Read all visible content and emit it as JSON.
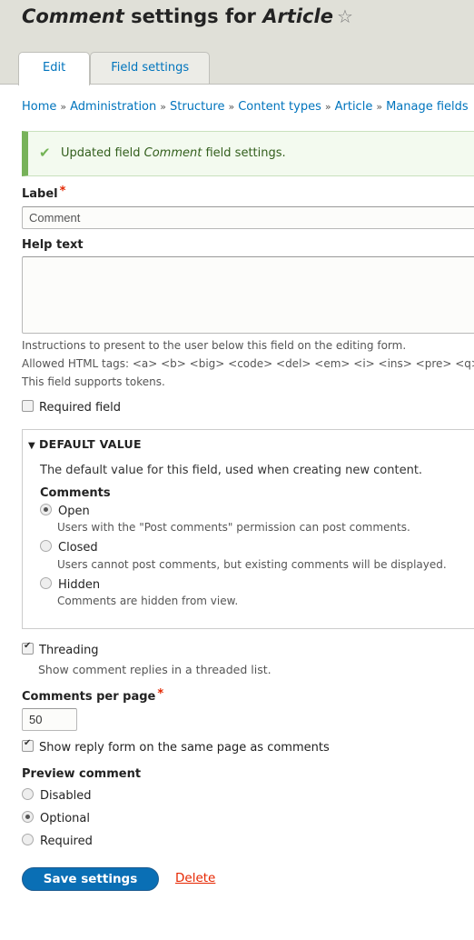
{
  "header": {
    "title_part1": "Comment",
    "title_part2": " settings for ",
    "title_part3": "Article",
    "star_icon": "☆"
  },
  "tabs": [
    {
      "label": "Edit",
      "active": true
    },
    {
      "label": "Field settings",
      "active": false
    }
  ],
  "breadcrumb": [
    "Home",
    "Administration",
    "Structure",
    "Content types",
    "Article",
    "Manage fields"
  ],
  "breadcrumb_separator": "»",
  "message": {
    "icon": "✔",
    "prefix": "Updated field ",
    "field": "Comment",
    "suffix": " field settings."
  },
  "label_field": {
    "label": "Label",
    "required_mark": "*",
    "value": "Comment"
  },
  "help_text": {
    "label": "Help text",
    "value": "",
    "desc1": "Instructions to present to the user below this field on the editing form.",
    "desc2": "Allowed HTML tags: <a> <b> <big> <code> <del> <em> <i> <ins> <pre> <q> <small> <span> <strong> <sub> <sup> <tt> <ol> <ul> <li> <p> <br> <img>",
    "desc3": "This field supports tokens."
  },
  "required_field": {
    "label": "Required field",
    "checked": false
  },
  "default_value": {
    "legend": "DEFAULT VALUE",
    "toggle_icon": "▼",
    "description": "The default value for this field, used when creating new content.",
    "group_label": "Comments",
    "options": [
      {
        "label": "Open",
        "desc": "Users with the \"Post comments\" permission can post comments.",
        "selected": true
      },
      {
        "label": "Closed",
        "desc": "Users cannot post comments, but existing comments will be displayed.",
        "selected": false
      },
      {
        "label": "Hidden",
        "desc": "Comments are hidden from view.",
        "selected": false
      }
    ]
  },
  "threading": {
    "label": "Threading",
    "checked": true,
    "desc": "Show comment replies in a threaded list."
  },
  "per_page": {
    "label": "Comments per page",
    "required_mark": "*",
    "value": "50"
  },
  "reply_form": {
    "label": "Show reply form on the same page as comments",
    "checked": true
  },
  "preview": {
    "label": "Preview comment",
    "options": [
      {
        "label": "Disabled",
        "selected": false
      },
      {
        "label": "Optional",
        "selected": true
      },
      {
        "label": "Required",
        "selected": false
      }
    ]
  },
  "actions": {
    "save": "Save settings",
    "delete": "Delete"
  }
}
